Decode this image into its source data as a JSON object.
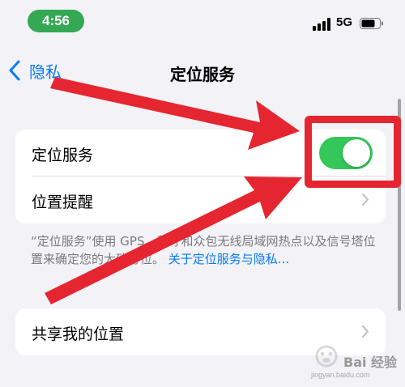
{
  "status_bar": {
    "time": "4:56",
    "network": "5G"
  },
  "nav": {
    "back_label": "隐私",
    "title": "定位服务"
  },
  "settings": {
    "location_services_label": "定位服务",
    "location_services_enabled": true,
    "location_alerts_label": "位置提醒",
    "share_location_label": "共享我的位置"
  },
  "footer": {
    "note": "“定位服务”使用 GPS、蓝牙和众包无线局域网热点以及信号塔位置来确定您的大致方位。",
    "link": "关于定位服务与隐私..."
  },
  "colors": {
    "accent": "#0a7aff",
    "toggle_on": "#34c759",
    "annotation": "#e52630"
  },
  "watermark": {
    "text": "Bai 经验",
    "sub": "jingyan.baidu.com"
  }
}
